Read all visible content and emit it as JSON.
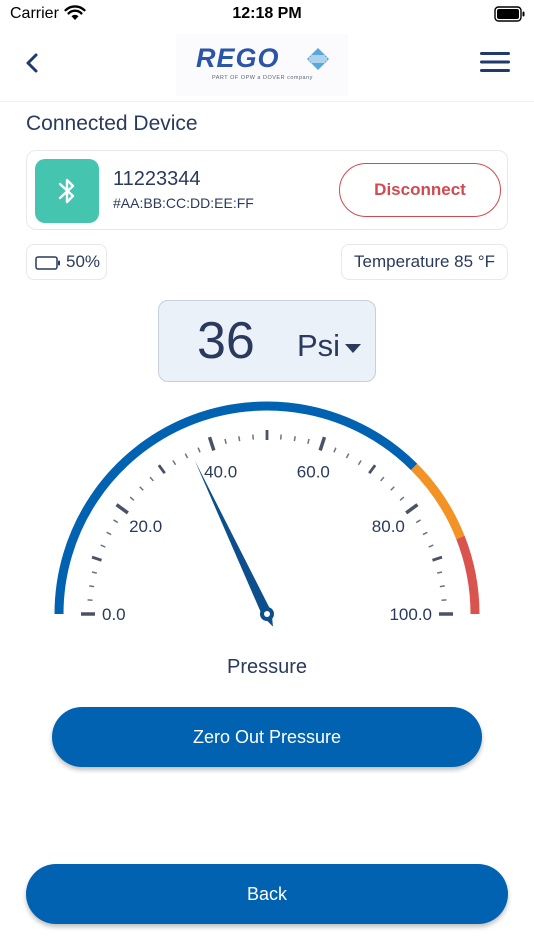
{
  "status_bar": {
    "carrier": "Carrier",
    "time": "12:18 PM"
  },
  "nav": {
    "logo_text": "REGO",
    "logo_tagline": "PART OF OPW  a DOVER company",
    "back_icon": "chevron-left-icon",
    "menu_icon": "hamburger-menu-icon"
  },
  "connected_device": {
    "title": "Connected Device",
    "icon": "bluetooth-icon",
    "name": "11223344",
    "mac": "#AA:BB:CC:DD:EE:FF",
    "disconnect_label": "Disconnect"
  },
  "battery": {
    "icon": "battery-icon",
    "label": "50%",
    "level": 0.5
  },
  "temperature": {
    "label": "Temperature 85 °F"
  },
  "reading": {
    "value": "36",
    "unit": "Psi"
  },
  "gauge": {
    "title": "Pressure",
    "min": 0,
    "max": 100,
    "value": 36,
    "tick_labels": [
      "0.0",
      "20.0",
      "40.0",
      "60.0",
      "80.0",
      "100.0"
    ],
    "zones": [
      {
        "from": 0,
        "to": 75,
        "color": "#0062b0"
      },
      {
        "from": 75,
        "to": 88,
        "color": "#f39325"
      },
      {
        "from": 88,
        "to": 100,
        "color": "#d9534f"
      }
    ]
  },
  "buttons": {
    "zero_out": "Zero Out Pressure",
    "back": "Back"
  },
  "colors": {
    "primary": "#0062b0",
    "accent_teal": "#45c4b0",
    "danger": "#d24a4f",
    "text": "#2a3a5c"
  }
}
